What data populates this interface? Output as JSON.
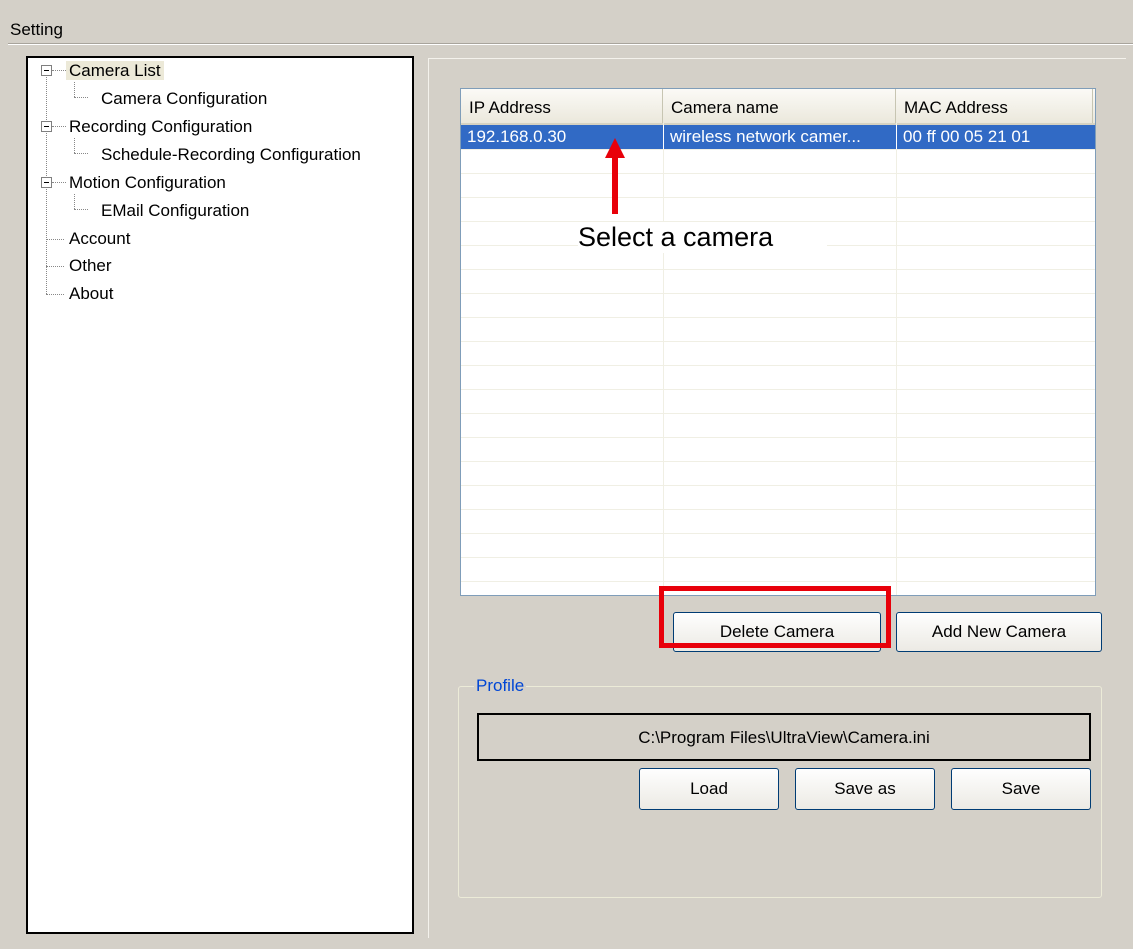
{
  "window": {
    "title": "Setting"
  },
  "tree": {
    "items": [
      {
        "label": "Camera List",
        "selected": true,
        "expanded": true
      },
      {
        "label": "Camera Configuration"
      },
      {
        "label": "Recording Configuration",
        "expanded": true
      },
      {
        "label": "Schedule-Recording Configuration"
      },
      {
        "label": "Motion Configuration",
        "expanded": true
      },
      {
        "label": "EMail Configuration"
      },
      {
        "label": "Account"
      },
      {
        "label": "Other"
      },
      {
        "label": "About"
      }
    ]
  },
  "camera_list": {
    "columns": [
      "IP Address",
      "Camera name",
      "MAC Address"
    ],
    "rows": [
      {
        "ip": "192.168.0.30",
        "name": "wireless network camer...",
        "mac": "00 ff 00 05 21 01",
        "selected": true
      }
    ],
    "selection_color": "#316ac5"
  },
  "buttons": {
    "delete_camera": "Delete Camera",
    "add_new_camera": "Add New Camera",
    "load": "Load",
    "save_as": "Save as",
    "save": "Save"
  },
  "profile": {
    "label": "Profile",
    "path": "C:\\Program Files\\UltraView\\Camera.ini"
  },
  "annotation": {
    "text": "Select a camera",
    "color": "#e8000a"
  }
}
